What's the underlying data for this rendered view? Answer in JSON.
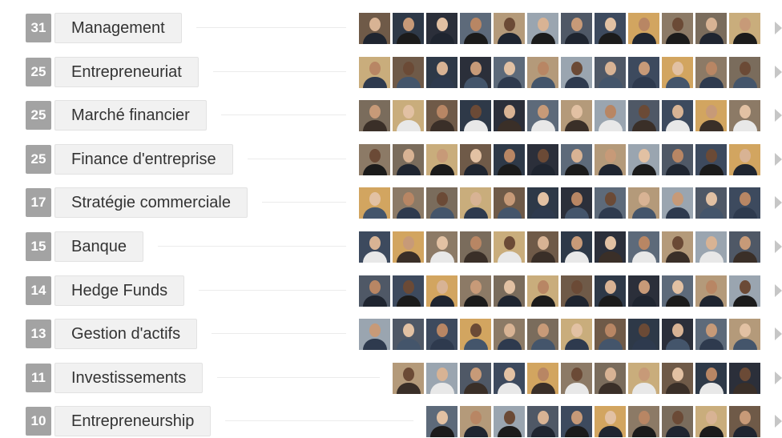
{
  "skills": [
    {
      "count": "31",
      "label": "Management",
      "avatars": 12
    },
    {
      "count": "25",
      "label": "Entrepreneuriat",
      "avatars": 12
    },
    {
      "count": "25",
      "label": "Marché financier",
      "avatars": 12
    },
    {
      "count": "25",
      "label": "Finance d'entreprise",
      "avatars": 12
    },
    {
      "count": "17",
      "label": "Stratégie commerciale",
      "avatars": 12
    },
    {
      "count": "15",
      "label": "Banque",
      "avatars": 12
    },
    {
      "count": "14",
      "label": "Hedge Funds",
      "avatars": 12
    },
    {
      "count": "13",
      "label": "Gestion d'actifs",
      "avatars": 12
    },
    {
      "count": "11",
      "label": "Investissements",
      "avatars": 11
    },
    {
      "count": "10",
      "label": "Entrepreneurship",
      "avatars": 10
    }
  ],
  "icons": {
    "expand": "chevron-right-icon",
    "endorser": "avatar-photo"
  },
  "colors": {
    "count_badge": "#a3a3a3",
    "label_bg": "#f1f1f1",
    "chevron": "#c6c6c6"
  }
}
